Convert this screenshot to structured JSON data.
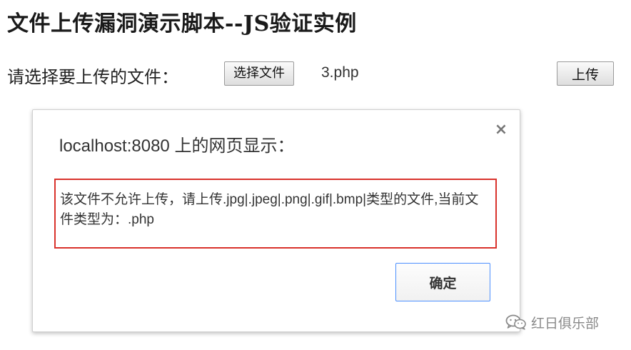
{
  "page": {
    "title": "文件上传漏洞演示脚本--JS验证实例"
  },
  "form": {
    "label": "请选择要上传的文件：",
    "choose_file_label": "选择文件",
    "selected_file": "3.php",
    "upload_label": "上传"
  },
  "dialog": {
    "title": "localhost:8080 上的网页显示：",
    "close_icon": "close-icon",
    "close_glyph": "×",
    "message": "该文件不允许上传，请上传.jpg|.jpeg|.png|.gif|.bmp|类型的文件,当前文件类型为：.php",
    "ok_label": "确定",
    "highlight_color": "#d9322c",
    "focus_color": "#4d90fe"
  },
  "watermark": {
    "icon": "wechat-icon",
    "text": "红日俱乐部"
  }
}
